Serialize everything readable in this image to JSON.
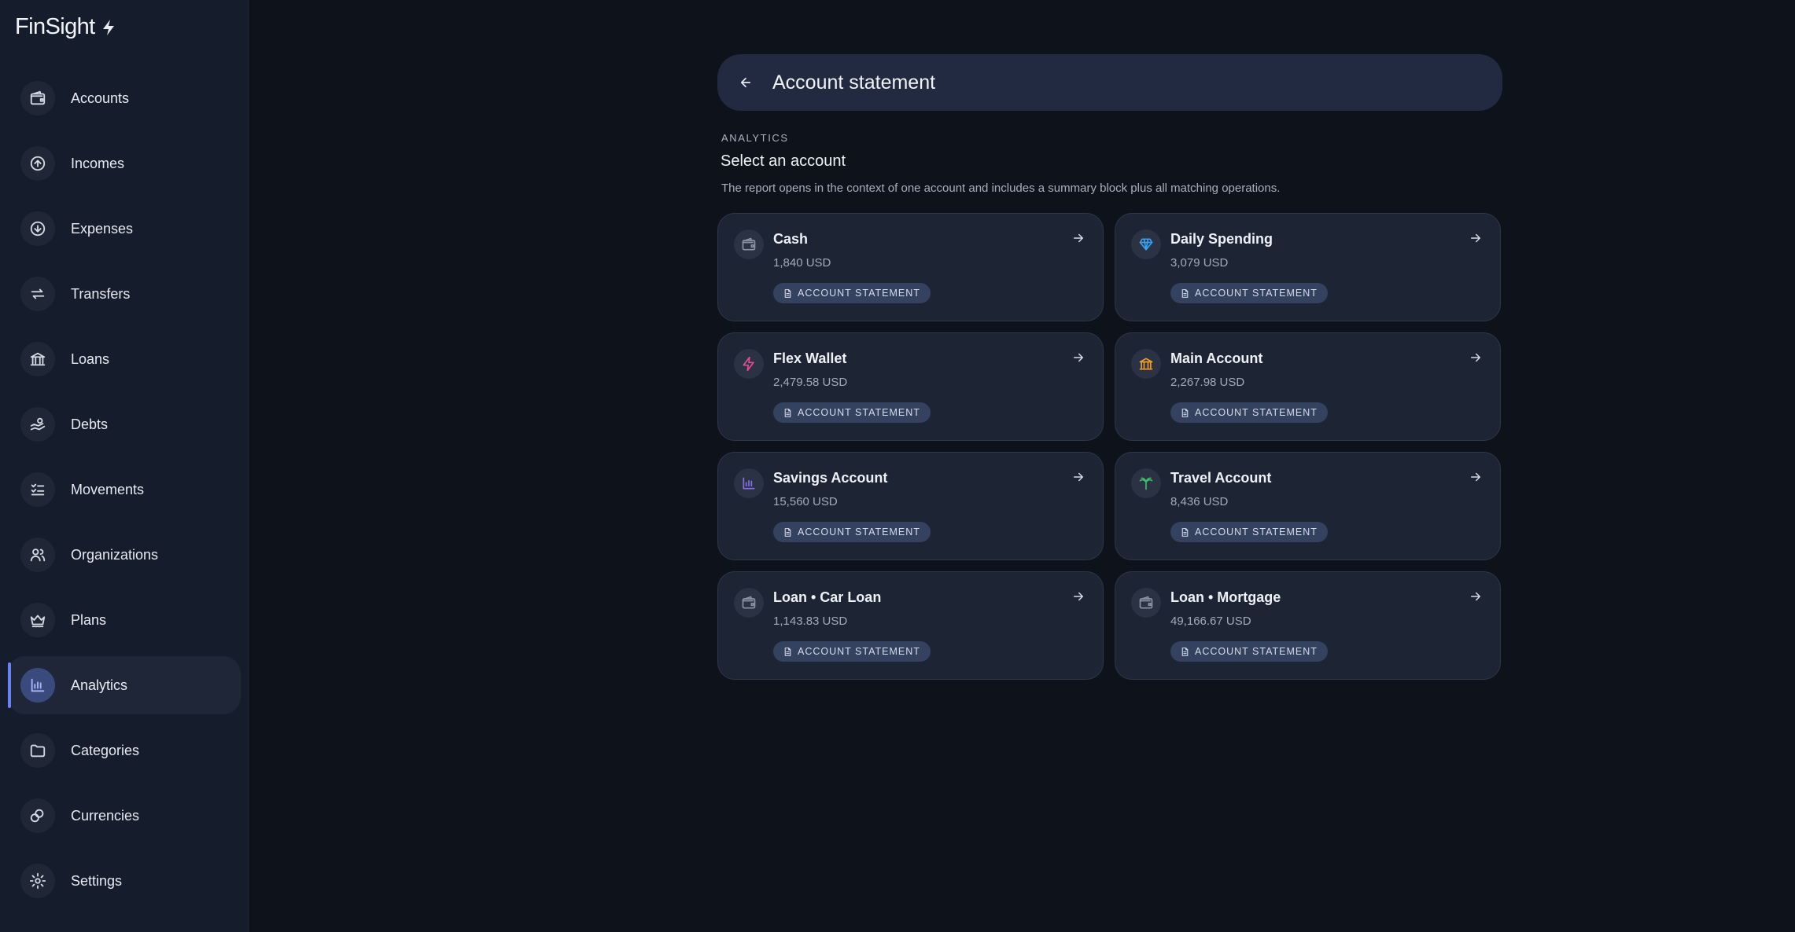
{
  "brand": {
    "name": "FinSight"
  },
  "sidebar": {
    "items": [
      {
        "label": "Accounts",
        "icon": "wallet-icon"
      },
      {
        "label": "Incomes",
        "icon": "arrow-up-circle-icon"
      },
      {
        "label": "Expenses",
        "icon": "arrow-down-circle-icon"
      },
      {
        "label": "Transfers",
        "icon": "repeat-icon"
      },
      {
        "label": "Loans",
        "icon": "bank-icon"
      },
      {
        "label": "Debts",
        "icon": "hand-coins-icon"
      },
      {
        "label": "Movements",
        "icon": "list-checks-icon"
      },
      {
        "label": "Organizations",
        "icon": "users-icon"
      },
      {
        "label": "Plans",
        "icon": "crown-icon"
      },
      {
        "label": "Analytics",
        "icon": "bar-chart-icon",
        "active": true
      },
      {
        "label": "Categories",
        "icon": "folder-icon"
      },
      {
        "label": "Currencies",
        "icon": "coins-icon"
      },
      {
        "label": "Settings",
        "icon": "gear-icon"
      }
    ]
  },
  "header": {
    "title": "Account statement"
  },
  "section": {
    "kicker": "ANALYTICS",
    "title": "Select an account",
    "description": "The report opens in the context of one account and includes a summary block plus all matching operations."
  },
  "accounts": [
    {
      "name": "Cash",
      "balance": "1,840 USD",
      "icon": "wallet-icon",
      "icon_color": "#8a92a3",
      "action": "ACCOUNT STATEMENT"
    },
    {
      "name": "Daily Spending",
      "balance": "3,079 USD",
      "icon": "diamond-icon",
      "icon_color": "#3aa0f0",
      "action": "ACCOUNT STATEMENT"
    },
    {
      "name": "Flex Wallet",
      "balance": "2,479.58 USD",
      "icon": "lightning-icon",
      "icon_color": "#e0508e",
      "action": "ACCOUNT STATEMENT"
    },
    {
      "name": "Main Account",
      "balance": "2,267.98 USD",
      "icon": "bank-icon",
      "icon_color": "#f0a02a",
      "action": "ACCOUNT STATEMENT"
    },
    {
      "name": "Savings Account",
      "balance": "15,560 USD",
      "icon": "bar-chart-icon",
      "icon_color": "#8e6cf0",
      "action": "ACCOUNT STATEMENT"
    },
    {
      "name": "Travel Account",
      "balance": "8,436 USD",
      "icon": "palm-tree-icon",
      "icon_color": "#3cc06a",
      "action": "ACCOUNT STATEMENT"
    },
    {
      "name": "Loan • Car Loan",
      "balance": "1,143.83 USD",
      "icon": "wallet-icon",
      "icon_color": "#8a92a3",
      "action": "ACCOUNT STATEMENT"
    },
    {
      "name": "Loan • Mortgage",
      "balance": "49,166.67 USD",
      "icon": "wallet-icon",
      "icon_color": "#8a92a3",
      "action": "ACCOUNT STATEMENT"
    }
  ]
}
